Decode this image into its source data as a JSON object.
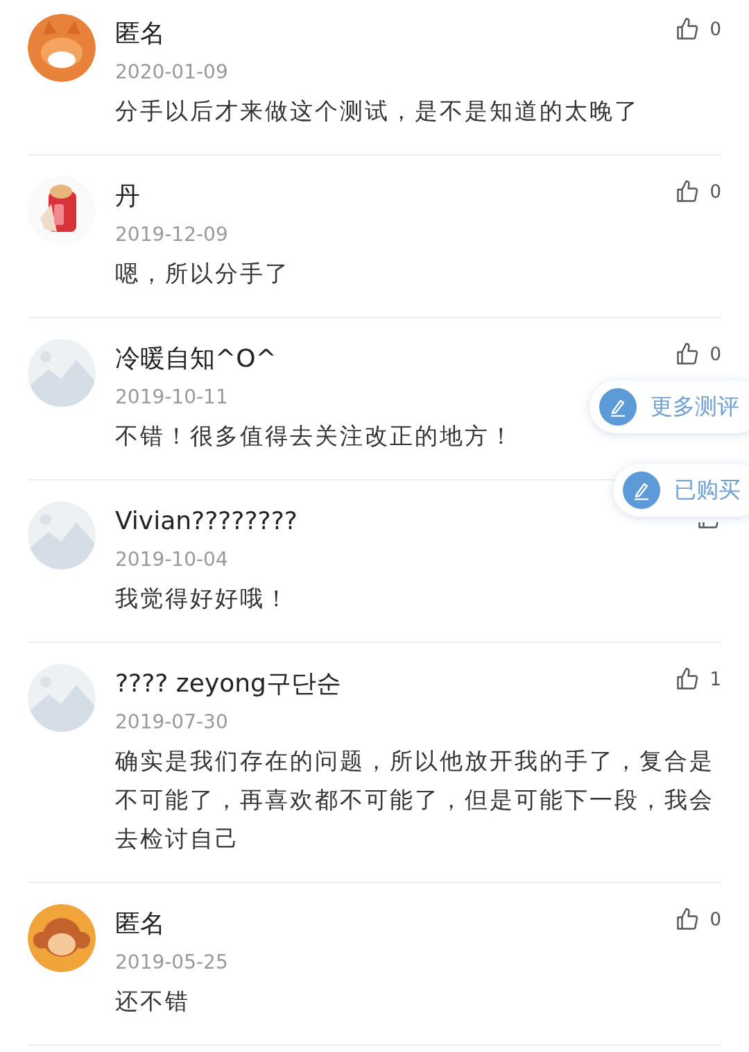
{
  "comments": [
    {
      "name": "匿名",
      "date": "2020-01-09",
      "likes": "0",
      "text": "分手以后才来做这个测试，是不是知道的太晚了"
    },
    {
      "name": "丹",
      "date": "2019-12-09",
      "likes": "0",
      "text": "嗯，所以分手了"
    },
    {
      "name": "冷暖自知^O^",
      "date": "2019-10-11",
      "likes": "0",
      "text": "不错！很多值得去关注改正的地方！"
    },
    {
      "name": "Vivian????????",
      "date": "2019-10-04",
      "text": "我觉得好好哦！"
    },
    {
      "name": "???? zeyong구단순",
      "date": "2019-07-30",
      "likes": "1",
      "text": "确实是我们存在的问题，所以他放开我的手了，复合是不可能了，再喜欢都不可能了，但是可能下一段，我会去检讨自己"
    },
    {
      "name": "匿名",
      "date": "2019-05-25",
      "likes": "0",
      "text": "还不错"
    }
  ],
  "floating_buttons": [
    {
      "label": "更多测评"
    },
    {
      "label": "已购买"
    }
  ]
}
